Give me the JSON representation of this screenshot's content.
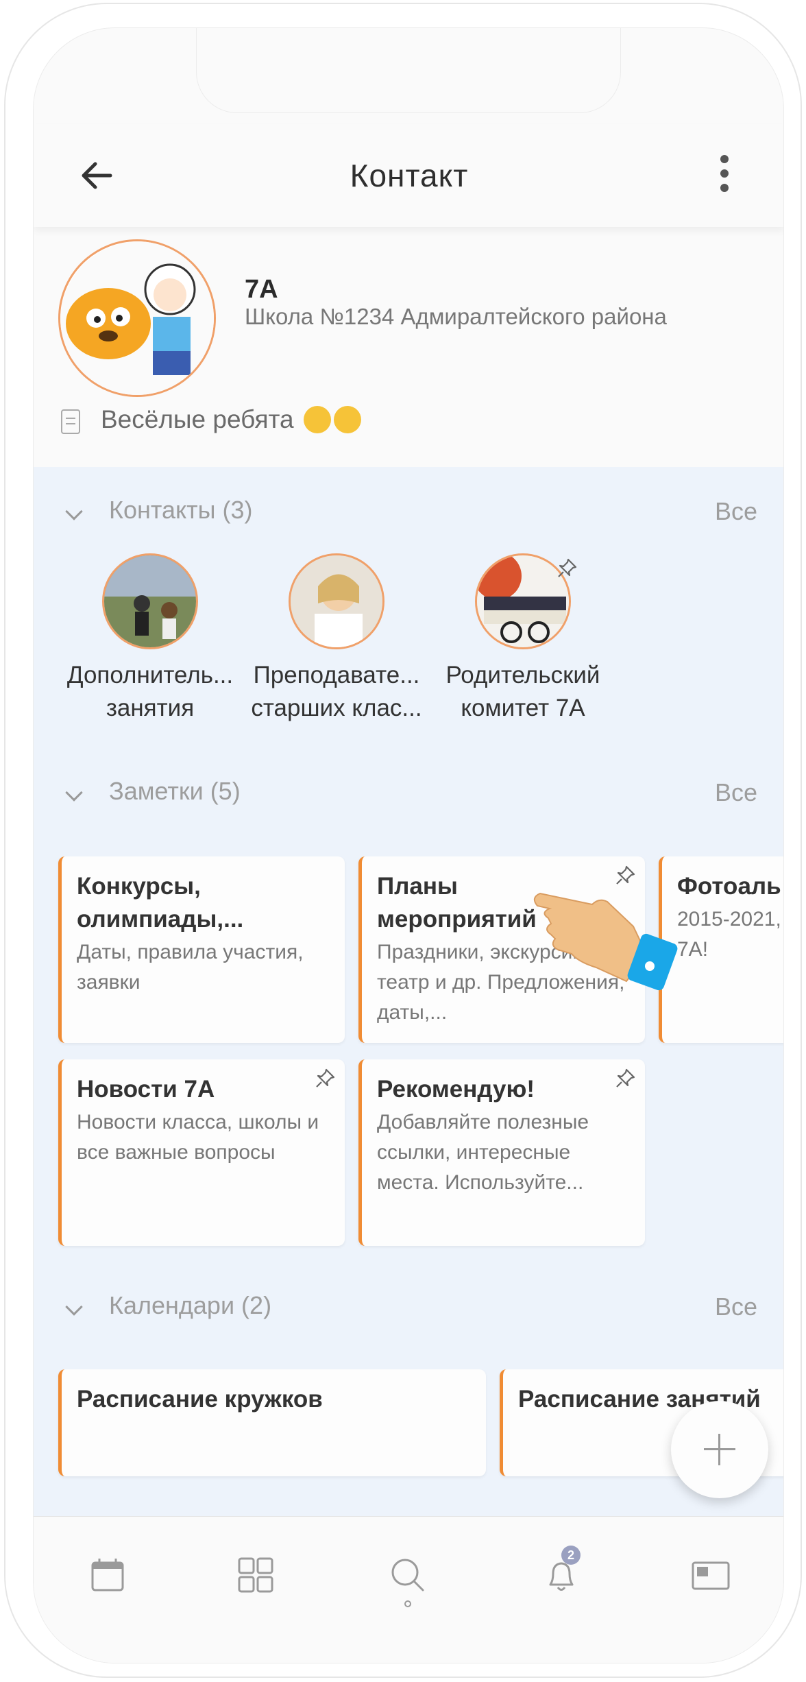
{
  "appbar": {
    "title": "Контакт"
  },
  "profile": {
    "name": "7А",
    "school": "Школа №1234 Адмиралтейского района",
    "status": "Весёлые ребята"
  },
  "contacts": {
    "title": "Контакты (3)",
    "all": "Все",
    "items": [
      {
        "line1": "Дополнитель...",
        "line2": "занятия",
        "pinned": false
      },
      {
        "line1": "Преподавате...",
        "line2": "старших клас...",
        "pinned": false
      },
      {
        "line1": "Родительский",
        "line2": "комитет 7А",
        "pinned": true
      }
    ]
  },
  "notes": {
    "title": "Заметки (5)",
    "all": "Все",
    "items": [
      {
        "title": "Конкурсы, олимпиады,...",
        "desc": "Даты, правила участия, заявки",
        "pinned": false
      },
      {
        "title": "Планы мероприятий",
        "desc": "Праздники, экскурсии, театр и др. Предложения, даты,...",
        "pinned": true
      },
      {
        "title": "Фотоаль",
        "desc": "2015-2021, 7А!",
        "pinned": false
      },
      {
        "title": "Новости 7А",
        "desc": "Новости класса, школы и все важные вопросы",
        "pinned": true
      },
      {
        "title": "Рекомендую!",
        "desc": "Добавляйте полезные ссылки, интересные места. Используйте...",
        "pinned": true
      }
    ]
  },
  "calendars": {
    "title": "Календари (2)",
    "all": "Все",
    "items": [
      {
        "title": "Расписание кружков"
      },
      {
        "title": "Расписание занятий"
      }
    ]
  },
  "tabbar": {
    "items": [
      "calendar-icon",
      "grid-icon",
      "search-icon",
      "bell-icon",
      "id-card-icon"
    ],
    "notifications_badge": "2"
  },
  "colors": {
    "accent": "#f08c34",
    "background": "#edf3fb",
    "badge": "#9aa0c0"
  }
}
